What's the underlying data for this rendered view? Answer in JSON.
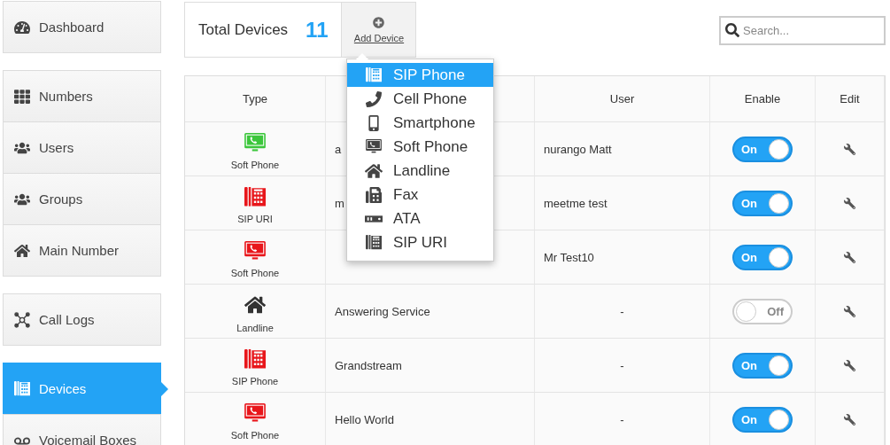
{
  "sidebar": {
    "sections": [
      {
        "items": [
          {
            "label": "Dashboard",
            "kind": "gauge",
            "selected": false
          }
        ]
      },
      {
        "items": [
          {
            "label": "Numbers",
            "kind": "grid",
            "selected": false
          },
          {
            "label": "Users",
            "kind": "users",
            "selected": false
          },
          {
            "label": "Groups",
            "kind": "group",
            "selected": false
          },
          {
            "label": "Main Number",
            "kind": "home",
            "selected": false
          }
        ]
      },
      {
        "items": [
          {
            "label": "Call Logs",
            "kind": "nodes",
            "selected": false
          }
        ]
      },
      {
        "items": [
          {
            "label": "Devices",
            "kind": "sip",
            "selected": true
          },
          {
            "label": "Voicemail Boxes",
            "kind": "voicemail",
            "selected": false
          }
        ]
      }
    ]
  },
  "summary": {
    "label": "Total Devices",
    "count": "11",
    "add_button": "Add Device"
  },
  "search": {
    "placeholder": "Search..."
  },
  "add_menu": {
    "items": [
      {
        "label": "SIP Phone",
        "kind": "sip",
        "selected": true
      },
      {
        "label": "Cell Phone",
        "kind": "phone",
        "selected": false
      },
      {
        "label": "Smartphone",
        "kind": "mobile",
        "selected": false
      },
      {
        "label": "Soft Phone",
        "kind": "soft",
        "selected": false
      },
      {
        "label": "Landline",
        "kind": "home",
        "selected": false
      },
      {
        "label": "Fax",
        "kind": "fax",
        "selected": false
      },
      {
        "label": "ATA",
        "kind": "ata",
        "selected": false
      },
      {
        "label": "SIP URI",
        "kind": "sip",
        "selected": false
      }
    ]
  },
  "table": {
    "columns": [
      "Type",
      "User",
      "Enable",
      "Edit"
    ],
    "rows": [
      {
        "type": "Soft Phone",
        "kind": "soft",
        "color": "#3cc63c",
        "name": "a",
        "user": "nurango Matt",
        "on": true,
        "toggle": "On"
      },
      {
        "type": "SIP URI",
        "kind": "sip",
        "color": "#e8161b",
        "name": "m",
        "user": "meetme test",
        "on": true,
        "toggle": "On"
      },
      {
        "type": "Soft Phone",
        "kind": "soft",
        "color": "#e8161b",
        "user": "Mr Test10",
        "on": true,
        "toggle": "On"
      },
      {
        "type": "Landline",
        "kind": "home",
        "color": "#333333",
        "name": "Answering Service",
        "user": "-",
        "on": false,
        "toggle": "Off"
      },
      {
        "type": "SIP Phone",
        "kind": "sip",
        "color": "#e8161b",
        "name": "Grandstream",
        "user": "-",
        "on": true,
        "toggle": "On"
      },
      {
        "type": "Soft Phone",
        "kind": "soft",
        "color": "#e8161b",
        "name": "Hello World",
        "user": "-",
        "on": true,
        "toggle": "On"
      }
    ]
  }
}
